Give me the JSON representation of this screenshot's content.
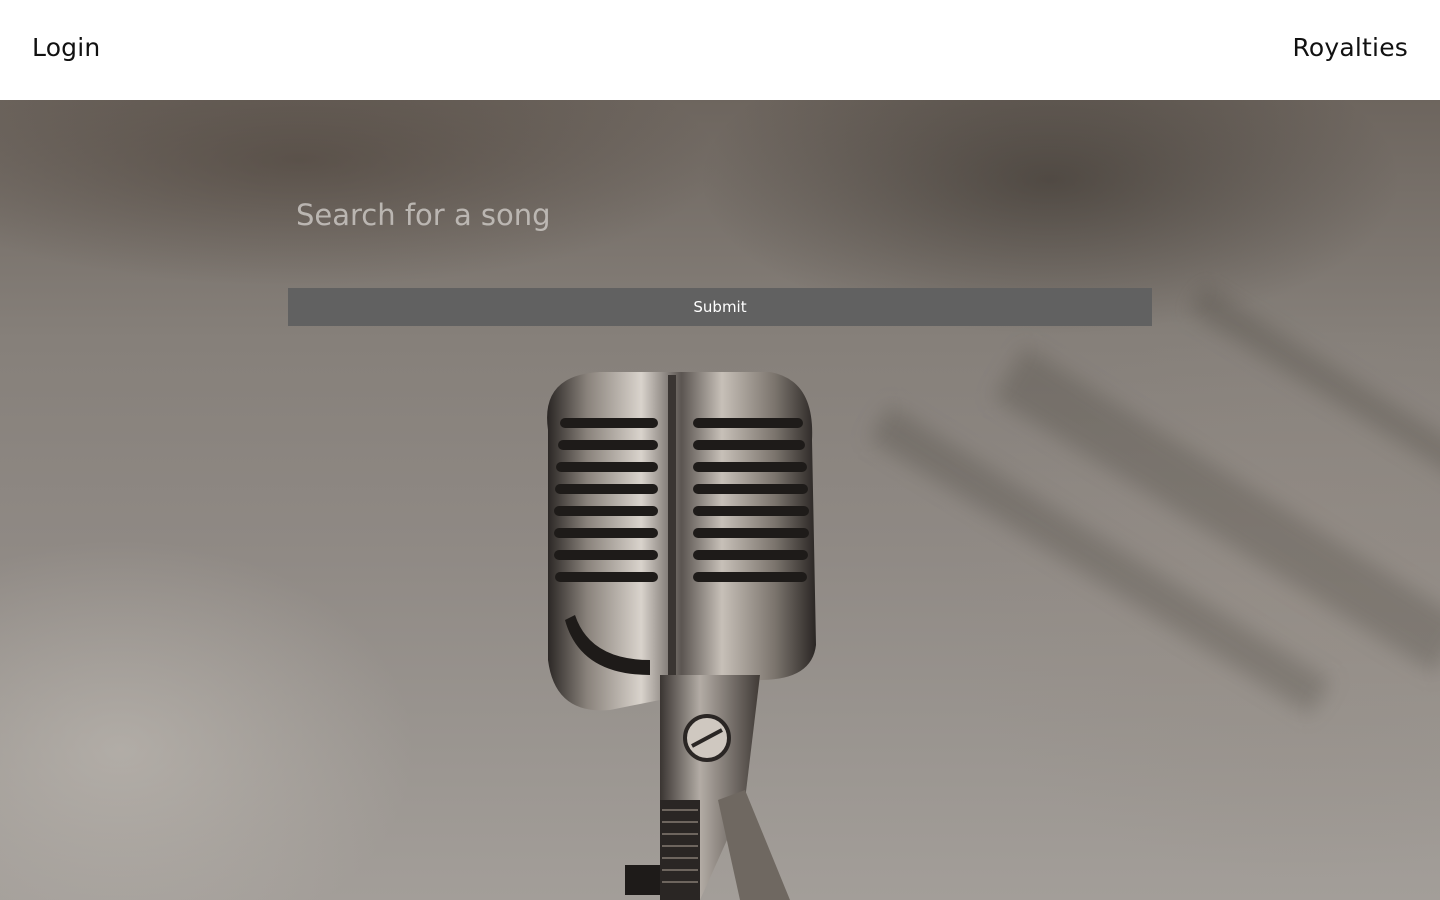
{
  "header": {
    "login_label": "Login",
    "royalties_label": "Royalties"
  },
  "search": {
    "placeholder": "Search for a song",
    "value": ""
  },
  "submit": {
    "label": "Submit"
  },
  "hero": {
    "image": "vintage-microphone-photo"
  },
  "colors": {
    "header_bg": "#ffffff",
    "button_bg": "#616161",
    "button_text": "#ffffff",
    "nav_text": "#111111"
  }
}
